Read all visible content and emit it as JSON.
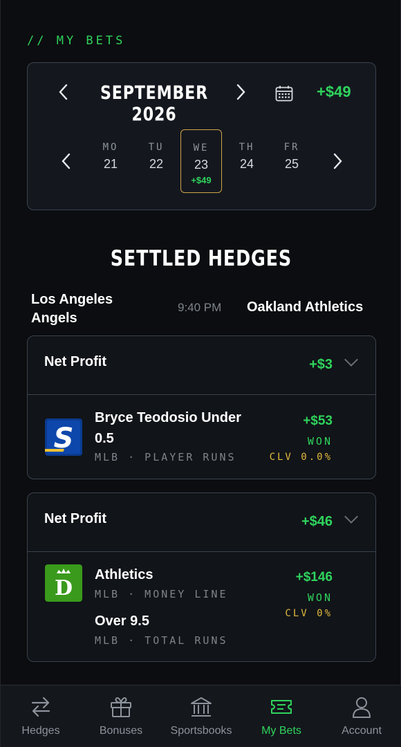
{
  "section_tag": "// MY BETS",
  "calendar": {
    "month_label": "SEPTEMBER 2026",
    "month_total": "+$49",
    "days": [
      {
        "dow": "MO",
        "num": "21",
        "delta": ""
      },
      {
        "dow": "TU",
        "num": "22",
        "delta": ""
      },
      {
        "dow": "WE",
        "num": "23",
        "delta": "+$49",
        "selected": true
      },
      {
        "dow": "TH",
        "num": "24",
        "delta": ""
      },
      {
        "dow": "FR",
        "num": "25",
        "delta": ""
      }
    ]
  },
  "settled": {
    "title": "SETTLED HEDGES",
    "match": {
      "team_left": "Los Angeles Angels",
      "time": "9:40 PM",
      "team_right": "Oakland Athletics"
    },
    "hedges": [
      {
        "net_profit_label": "Net Profit",
        "net_profit_value": "+$3",
        "bets": [
          {
            "book": "theScore Bet",
            "title": "Bryce Teodosio Under 0.5",
            "meta": "MLB · PLAYER RUNS",
            "amount": "+$53",
            "result": "WON",
            "clv": "CLV 0.0%"
          }
        ]
      },
      {
        "net_profit_label": "Net Profit",
        "net_profit_value": "+$46",
        "bets": [
          {
            "book": "DraftKings",
            "title": "Athletics",
            "meta": "MLB · MONEY LINE",
            "amount": "+$146",
            "result": "WON",
            "clv": "CLV 0%"
          },
          {
            "title": "Over 9.5",
            "meta": "MLB · TOTAL RUNS"
          }
        ]
      }
    ]
  },
  "tabs": [
    {
      "label": "Hedges",
      "icon": "swap-arrows-icon"
    },
    {
      "label": "Bonuses",
      "icon": "gift-icon"
    },
    {
      "label": "Sportsbooks",
      "icon": "bank-icon"
    },
    {
      "label": "My Bets",
      "icon": "ticket-icon",
      "active": true
    },
    {
      "label": "Account",
      "icon": "user-icon"
    }
  ],
  "colors": {
    "accent_green": "#2fd35d",
    "clv_gold": "#e3b93f",
    "selected_day_border": "#d1a34a",
    "card_border": "#3a4350",
    "background": "#0c0d10"
  }
}
